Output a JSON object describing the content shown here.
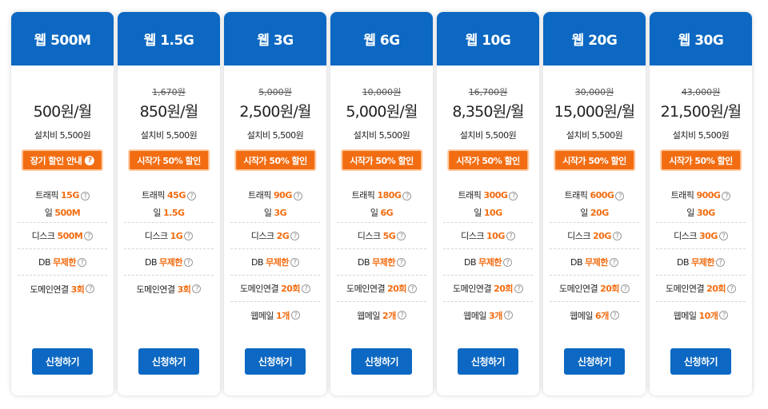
{
  "common": {
    "setup_fee": "설치비 5,500원",
    "apply_label": "신청하기",
    "help_icon": "?",
    "info_icon": "?"
  },
  "plans": [
    {
      "name": "웹 500M",
      "original_price": "",
      "price": "500원/월",
      "badge": "장기 할인 안내",
      "badge_has_icon": true,
      "traffic": {
        "label": "트래픽",
        "value": "15G",
        "daily_label": "일",
        "daily_value": "500M"
      },
      "disk": {
        "label": "디스크",
        "value": "500M"
      },
      "db": {
        "label": "DB",
        "value": "무제한"
      },
      "domain": {
        "label": "도메인연결",
        "value": "3회"
      },
      "webmail": null
    },
    {
      "name": "웹 1.5G",
      "original_price": "1,670원",
      "price": "850원/월",
      "badge": "시작가 50% 할인",
      "badge_has_icon": false,
      "traffic": {
        "label": "트래픽",
        "value": "45G",
        "daily_label": "일",
        "daily_value": "1.5G"
      },
      "disk": {
        "label": "디스크",
        "value": "1G"
      },
      "db": {
        "label": "DB",
        "value": "무제한"
      },
      "domain": {
        "label": "도메인연결",
        "value": "3회"
      },
      "webmail": null
    },
    {
      "name": "웹 3G",
      "original_price": "5,000원",
      "price": "2,500원/월",
      "badge": "시작가 50% 할인",
      "badge_has_icon": false,
      "traffic": {
        "label": "트래픽",
        "value": "90G",
        "daily_label": "일",
        "daily_value": "3G"
      },
      "disk": {
        "label": "디스크",
        "value": "2G"
      },
      "db": {
        "label": "DB",
        "value": "무제한"
      },
      "domain": {
        "label": "도메인연결",
        "value": "20회"
      },
      "webmail": {
        "label": "웹메일",
        "value": "1개"
      }
    },
    {
      "name": "웹 6G",
      "original_price": "10,000원",
      "price": "5,000원/월",
      "badge": "시작가 50% 할인",
      "badge_has_icon": false,
      "traffic": {
        "label": "트래픽",
        "value": "180G",
        "daily_label": "일",
        "daily_value": "6G"
      },
      "disk": {
        "label": "디스크",
        "value": "5G"
      },
      "db": {
        "label": "DB",
        "value": "무제한"
      },
      "domain": {
        "label": "도메인연결",
        "value": "20회"
      },
      "webmail": {
        "label": "웹메일",
        "value": "2개"
      }
    },
    {
      "name": "웹 10G",
      "original_price": "16,700원",
      "price": "8,350원/월",
      "badge": "시작가 50% 할인",
      "badge_has_icon": false,
      "traffic": {
        "label": "트래픽",
        "value": "300G",
        "daily_label": "일",
        "daily_value": "10G"
      },
      "disk": {
        "label": "디스크",
        "value": "10G"
      },
      "db": {
        "label": "DB",
        "value": "무제한"
      },
      "domain": {
        "label": "도메인연결",
        "value": "20회"
      },
      "webmail": {
        "label": "웹메일",
        "value": "3개"
      }
    },
    {
      "name": "웹 20G",
      "original_price": "30,000원",
      "price": "15,000원/월",
      "badge": "시작가 50% 할인",
      "badge_has_icon": false,
      "traffic": {
        "label": "트래픽",
        "value": "600G",
        "daily_label": "일",
        "daily_value": "20G"
      },
      "disk": {
        "label": "디스크",
        "value": "20G"
      },
      "db": {
        "label": "DB",
        "value": "무제한"
      },
      "domain": {
        "label": "도메인연결",
        "value": "20회"
      },
      "webmail": {
        "label": "웹메일",
        "value": "6개"
      }
    },
    {
      "name": "웹 30G",
      "original_price": "43,000원",
      "price": "21,500원/월",
      "badge": "시작가 50% 할인",
      "badge_has_icon": false,
      "traffic": {
        "label": "트래픽",
        "value": "900G",
        "daily_label": "일",
        "daily_value": "30G"
      },
      "disk": {
        "label": "디스크",
        "value": "30G"
      },
      "db": {
        "label": "DB",
        "value": "무제한"
      },
      "domain": {
        "label": "도메인연결",
        "value": "20회"
      },
      "webmail": {
        "label": "웹메일",
        "value": "10개"
      }
    }
  ],
  "colors": {
    "header_blue": "#0c68c2",
    "accent_orange": "#f26d12"
  }
}
